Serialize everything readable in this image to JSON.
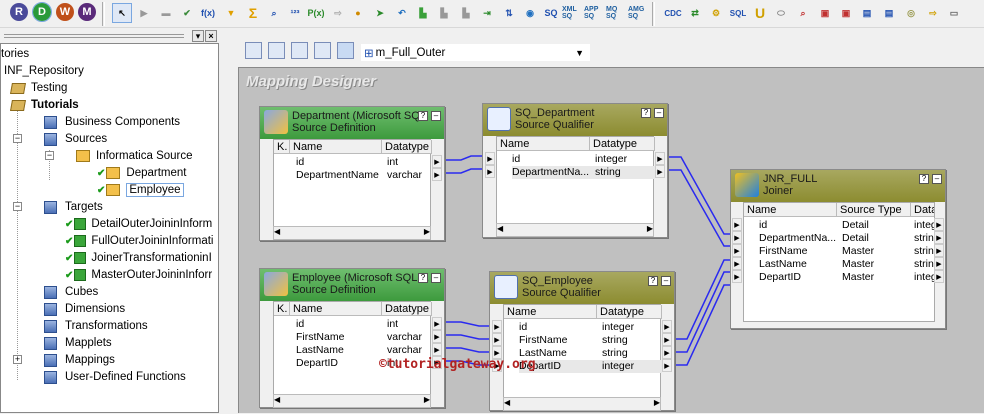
{
  "toolbar": {
    "left_buttons": [
      "R",
      "D",
      "W",
      "M"
    ],
    "tool_labels": [
      "f(x)",
      "P(x)",
      "SQ",
      "XML SQ",
      "APP SQ",
      "MQ SQ",
      "AMG SQ",
      "CDC",
      "SQL",
      "U"
    ]
  },
  "navigator": {
    "items": [
      {
        "label": "tories"
      },
      {
        "label": "INF_Repository"
      },
      {
        "label": "Testing"
      },
      {
        "label": "Tutorials"
      },
      {
        "label": "Business Components"
      },
      {
        "label": "Sources"
      },
      {
        "label": "Informatica Source"
      },
      {
        "label": "Department"
      },
      {
        "label": "Employee"
      },
      {
        "label": "Targets"
      },
      {
        "label": "DetailOuterJoininInform"
      },
      {
        "label": "FullOuterJoininInformati"
      },
      {
        "label": "JoinerTransformationinI"
      },
      {
        "label": "MasterOuterJoininInforr"
      },
      {
        "label": "Cubes"
      },
      {
        "label": "Dimensions"
      },
      {
        "label": "Transformations"
      },
      {
        "label": "Mapplets"
      },
      {
        "label": "Mappings"
      },
      {
        "label": "User-Defined Functions"
      }
    ]
  },
  "designer": {
    "mapping_dropdown": "m_Full_Outer",
    "canvas_title": "Mapping Designer",
    "watermark": "©tutorialgateway.org",
    "col_k": "K.",
    "col_name": "Name",
    "col_datatype": "Datatype",
    "col_source_type": "Source Type",
    "col_data_trunc": "Data",
    "dept": {
      "title": "Department (Microsoft SQ...",
      "subtitle": "Source Definition",
      "rows": [
        {
          "name": "id",
          "type": "int"
        },
        {
          "name": "DepartmentName",
          "type": "varchar"
        }
      ]
    },
    "sq_dept": {
      "title": "SQ_Department",
      "subtitle": "Source Qualifier",
      "rows": [
        {
          "name": "id",
          "type": "integer"
        },
        {
          "name": "DepartmentNa...",
          "type": "string"
        }
      ]
    },
    "emp": {
      "title": "Employee (Microsoft SQL ...",
      "subtitle": "Source Definition",
      "rows": [
        {
          "name": "id",
          "type": "int"
        },
        {
          "name": "FirstName",
          "type": "varchar"
        },
        {
          "name": "LastName",
          "type": "varchar"
        },
        {
          "name": "DepartID",
          "type": "int"
        }
      ]
    },
    "sq_emp": {
      "title": "SQ_Employee",
      "subtitle": "Source Qualifier",
      "rows": [
        {
          "name": "id",
          "type": "integer"
        },
        {
          "name": "FirstName",
          "type": "string"
        },
        {
          "name": "LastName",
          "type": "string"
        },
        {
          "name": "DepartID",
          "type": "integer"
        }
      ]
    },
    "joiner": {
      "title": "JNR_FULL",
      "subtitle": "Joiner",
      "rows": [
        {
          "name": "id",
          "src": "Detail",
          "type": "integ"
        },
        {
          "name": "DepartmentNa...",
          "src": "Detail",
          "type": "string"
        },
        {
          "name": "FirstName",
          "src": "Master",
          "type": "string"
        },
        {
          "name": "LastName",
          "src": "Master",
          "type": "string"
        },
        {
          "name": "DepartID",
          "src": "Master",
          "type": "integ"
        }
      ]
    }
  }
}
